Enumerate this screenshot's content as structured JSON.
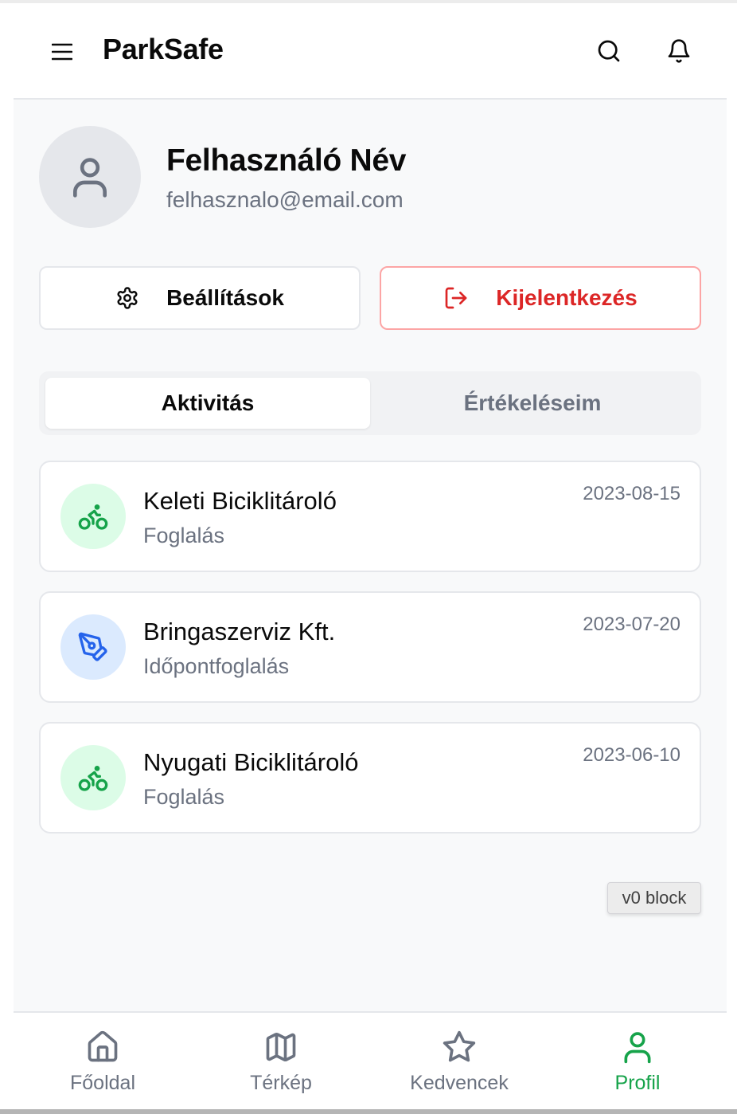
{
  "app": {
    "title": "ParkSafe"
  },
  "header": {
    "menu_icon": "menu-icon",
    "search_icon": "search-icon",
    "notifications_icon": "bell-icon"
  },
  "profile": {
    "name": "Felhasználó Név",
    "email": "felhasznalo@email.com",
    "avatar_icon": "user-icon"
  },
  "actions": {
    "settings_label": "Beállítások",
    "settings_icon": "gear-icon",
    "logout_label": "Kijelentkezés",
    "logout_icon": "logout-icon"
  },
  "tabs": [
    {
      "label": "Aktivitás",
      "active": true
    },
    {
      "label": "Értékeléseim",
      "active": false
    }
  ],
  "activities": [
    {
      "title": "Keleti Biciklitároló",
      "subtitle": "Foglalás",
      "date": "2023-08-15",
      "icon": "bike-icon",
      "icon_color": "#16a34a",
      "icon_bg": "#dcfce7"
    },
    {
      "title": "Bringaszerviz Kft.",
      "subtitle": "Időpontfoglalás",
      "date": "2023-07-20",
      "icon": "wrench-pen-icon",
      "icon_color": "#2563eb",
      "icon_bg": "#dbeafe"
    },
    {
      "title": "Nyugati Biciklitároló",
      "subtitle": "Foglalás",
      "date": "2023-06-10",
      "icon": "bike-icon",
      "icon_color": "#16a34a",
      "icon_bg": "#dcfce7"
    }
  ],
  "badge": {
    "label": "v0 block"
  },
  "bottom_nav": [
    {
      "label": "Főoldal",
      "icon": "home-icon",
      "active": false
    },
    {
      "label": "Térkép",
      "icon": "map-icon",
      "active": false
    },
    {
      "label": "Kedvencek",
      "icon": "star-icon",
      "active": false
    },
    {
      "label": "Profil",
      "icon": "user-icon",
      "active": true
    }
  ],
  "colors": {
    "accent_green": "#16a34a",
    "danger_red": "#dc2626",
    "muted_text": "#6b7280",
    "background": "#f8f9fa"
  }
}
